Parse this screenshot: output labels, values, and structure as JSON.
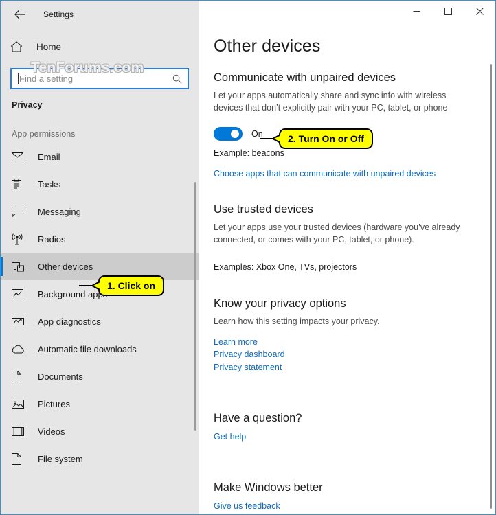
{
  "window": {
    "title": "Settings",
    "back_icon": "back-arrow-icon",
    "minimize_label": "—",
    "maximize_label": "□",
    "close_label": "✕"
  },
  "watermark": {
    "text": "TenForums.com"
  },
  "sidebar": {
    "home_label": "Home",
    "home_icon": "home-icon",
    "search": {
      "placeholder": "Find a setting",
      "icon": "search-icon"
    },
    "category": "Privacy",
    "group_label": "App permissions",
    "items": [
      {
        "label": "Email",
        "icon": "envelope-icon",
        "selected": false
      },
      {
        "label": "Tasks",
        "icon": "clipboard-icon",
        "selected": false
      },
      {
        "label": "Messaging",
        "icon": "speech-bubble-icon",
        "selected": false
      },
      {
        "label": "Radios",
        "icon": "radio-tower-icon",
        "selected": false
      },
      {
        "label": "Other devices",
        "icon": "devices-icon",
        "selected": true
      },
      {
        "label": "Background apps",
        "icon": "chart-window-icon",
        "selected": false
      },
      {
        "label": "App diagnostics",
        "icon": "diagnostics-icon",
        "selected": false
      },
      {
        "label": "Automatic file downloads",
        "icon": "cloud-icon",
        "selected": false
      },
      {
        "label": "Documents",
        "icon": "document-icon",
        "selected": false
      },
      {
        "label": "Pictures",
        "icon": "picture-icon",
        "selected": false
      },
      {
        "label": "Videos",
        "icon": "video-icon",
        "selected": false
      },
      {
        "label": "File system",
        "icon": "document-icon",
        "selected": false
      }
    ]
  },
  "main": {
    "page_title": "Other devices",
    "communicate": {
      "heading": "Communicate with unpaired devices",
      "description": "Let your apps automatically share and sync info with wireless devices that don’t explicitly pair with your PC, tablet, or phone",
      "toggle_state": "On",
      "toggle_on": true,
      "example": "Example: beacons",
      "link": "Choose apps that can communicate with unpaired devices"
    },
    "trusted": {
      "heading": "Use trusted devices",
      "description": "Let your apps use your trusted devices (hardware you’ve already connected, or comes with your PC, tablet, or phone).",
      "examples": "Examples: Xbox One, TVs, projectors"
    },
    "privacy_options": {
      "heading": "Know your privacy options",
      "description": "Learn how this setting impacts your privacy.",
      "links": [
        "Learn more",
        "Privacy dashboard",
        "Privacy statement"
      ]
    },
    "question": {
      "heading": "Have a question?",
      "link": "Get help"
    },
    "feedback": {
      "heading": "Make Windows better",
      "link": "Give us feedback"
    }
  },
  "callouts": [
    {
      "text": "1. Click on"
    },
    {
      "text": "2. Turn On or Off"
    }
  ],
  "colors": {
    "accent": "#0078d7",
    "link": "#0f6cbd",
    "callout_bg": "#ffff00",
    "sidebar_bg": "#e6e6e6",
    "selected_bg": "#cccccc"
  }
}
